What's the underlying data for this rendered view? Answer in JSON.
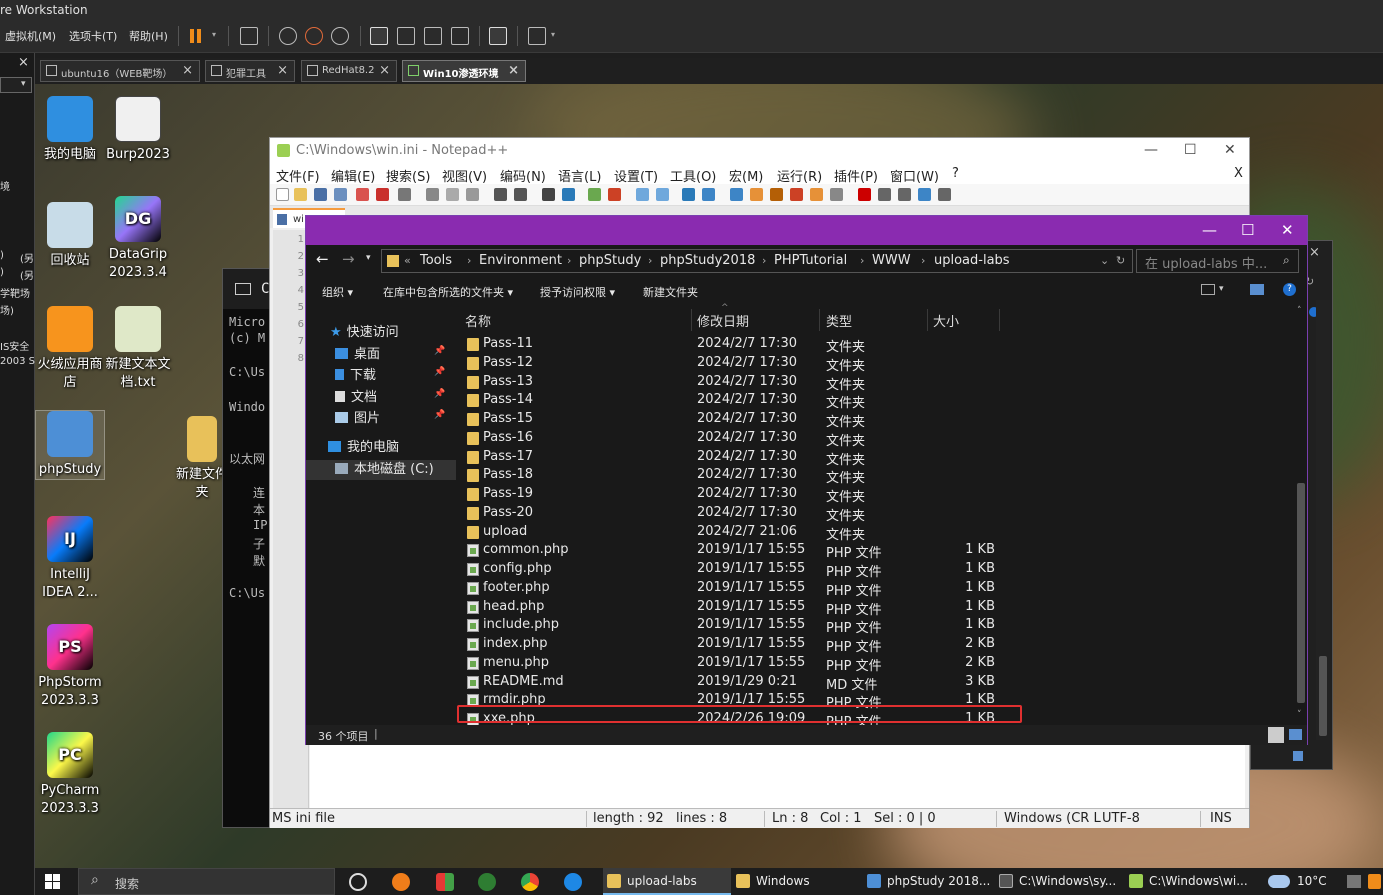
{
  "vmware": {
    "title": "re Workstation",
    "menus": [
      "虚拟机(M)",
      "选项卡(T)",
      "帮助(H)"
    ],
    "tabs": [
      {
        "label": "ubuntu16（WEB靶场）"
      },
      {
        "label": "犯罪工具"
      },
      {
        "label": "RedHat8.2"
      },
      {
        "label": "Win10渗透环境",
        "active": true
      }
    ],
    "library_fragments": [
      "境",
      ")",
      "(另",
      ")",
      "(另",
      "学靶场",
      "场)",
      "IS安全",
      "2003 S"
    ]
  },
  "desktop": {
    "icons": [
      {
        "label": "我的电脑"
      },
      {
        "label": "Burp2023"
      },
      {
        "label": "回收站"
      },
      {
        "label": "DataGrip 2023.3.4",
        "badge": "DG"
      },
      {
        "label": "火绒应用商店"
      },
      {
        "label": "新建文本文档.txt"
      },
      {
        "label": "phpStudy"
      },
      {
        "label": "新建文件夹"
      },
      {
        "label": "IntelliJ IDEA 2...",
        "badge": "IJ"
      },
      {
        "label": "PhpStorm 2023.3.3",
        "badge": "PS"
      },
      {
        "label": "PyCharm 2023.3.3",
        "badge": "PC"
      }
    ]
  },
  "cmd": {
    "title_icon": "C",
    "lines": [
      "Micro",
      "(c) M",
      "C:\\Us",
      "Windo",
      "以太网",
      "连",
      "本",
      "IP",
      "子",
      "默",
      "C:\\Us"
    ]
  },
  "notepad": {
    "title": "C:\\Windows\\win.ini - Notepad++",
    "menus": [
      "文件(F)",
      "编辑(E)",
      "搜索(S)",
      "视图(V)",
      "编码(N)",
      "语言(L)",
      "设置(T)",
      "工具(O)",
      "宏(M)",
      "运行(R)",
      "插件(P)",
      "窗口(W)",
      "?"
    ],
    "close_x": "X",
    "tab_label": "wi",
    "line_numbers": [
      "1",
      "2",
      "3",
      "4",
      "5",
      "6",
      "7",
      "8"
    ],
    "status": {
      "filetype": "MS ini file",
      "length": "length : 92",
      "lines": "lines : 8",
      "ln": "Ln : 8",
      "col": "Col : 1",
      "sel": "Sel : 0 | 0",
      "eol": "Windows (CR L",
      "encoding": "UTF-8",
      "mode": "INS"
    }
  },
  "explorer": {
    "breadcrumbs": [
      "Tools",
      "Environment",
      "phpStudy",
      "phpStudy2018",
      "PHPTutorial",
      "WWW",
      "upload-labs"
    ],
    "search_placeholder": "在 upload-labs 中...",
    "commands": [
      "组织",
      "在库中包含所选的文件夹",
      "授予访问权限",
      "新建文件夹"
    ],
    "nav": {
      "quick_access": "快速访问",
      "items": [
        "桌面",
        "下载",
        "文档",
        "图片"
      ],
      "this_pc": "我的电脑",
      "local_disk": "本地磁盘 (C:)"
    },
    "columns": [
      "名称",
      "修改日期",
      "类型",
      "大小"
    ],
    "rows": [
      {
        "name": "Pass-11",
        "date": "2024/2/7 17:30",
        "type": "文件夹",
        "size": "",
        "kind": "folder"
      },
      {
        "name": "Pass-12",
        "date": "2024/2/7 17:30",
        "type": "文件夹",
        "size": "",
        "kind": "folder"
      },
      {
        "name": "Pass-13",
        "date": "2024/2/7 17:30",
        "type": "文件夹",
        "size": "",
        "kind": "folder"
      },
      {
        "name": "Pass-14",
        "date": "2024/2/7 17:30",
        "type": "文件夹",
        "size": "",
        "kind": "folder"
      },
      {
        "name": "Pass-15",
        "date": "2024/2/7 17:30",
        "type": "文件夹",
        "size": "",
        "kind": "folder"
      },
      {
        "name": "Pass-16",
        "date": "2024/2/7 17:30",
        "type": "文件夹",
        "size": "",
        "kind": "folder"
      },
      {
        "name": "Pass-17",
        "date": "2024/2/7 17:30",
        "type": "文件夹",
        "size": "",
        "kind": "folder"
      },
      {
        "name": "Pass-18",
        "date": "2024/2/7 17:30",
        "type": "文件夹",
        "size": "",
        "kind": "folder"
      },
      {
        "name": "Pass-19",
        "date": "2024/2/7 17:30",
        "type": "文件夹",
        "size": "",
        "kind": "folder"
      },
      {
        "name": "Pass-20",
        "date": "2024/2/7 17:30",
        "type": "文件夹",
        "size": "",
        "kind": "folder"
      },
      {
        "name": "upload",
        "date": "2024/2/7 21:06",
        "type": "文件夹",
        "size": "",
        "kind": "folder"
      },
      {
        "name": "common.php",
        "date": "2019/1/17 15:55",
        "type": "PHP 文件",
        "size": "1 KB",
        "kind": "php"
      },
      {
        "name": "config.php",
        "date": "2019/1/17 15:55",
        "type": "PHP 文件",
        "size": "1 KB",
        "kind": "php"
      },
      {
        "name": "footer.php",
        "date": "2019/1/17 15:55",
        "type": "PHP 文件",
        "size": "1 KB",
        "kind": "php"
      },
      {
        "name": "head.php",
        "date": "2019/1/17 15:55",
        "type": "PHP 文件",
        "size": "1 KB",
        "kind": "php"
      },
      {
        "name": "include.php",
        "date": "2019/1/17 15:55",
        "type": "PHP 文件",
        "size": "1 KB",
        "kind": "php"
      },
      {
        "name": "index.php",
        "date": "2019/1/17 15:55",
        "type": "PHP 文件",
        "size": "2 KB",
        "kind": "php"
      },
      {
        "name": "menu.php",
        "date": "2019/1/17 15:55",
        "type": "PHP 文件",
        "size": "2 KB",
        "kind": "php"
      },
      {
        "name": "README.md",
        "date": "2019/1/29 0:21",
        "type": "MD 文件",
        "size": "3 KB",
        "kind": "php"
      },
      {
        "name": "rmdir.php",
        "date": "2019/1/17 15:55",
        "type": "PHP 文件",
        "size": "1 KB",
        "kind": "php"
      },
      {
        "name": "xxe.php",
        "date": "2024/2/26 19:09",
        "type": "PHP 文件",
        "size": "1 KB",
        "kind": "php",
        "highlighted": true
      }
    ],
    "item_count": "36 个项目"
  },
  "taskbar": {
    "search_label": "搜索",
    "tasks": [
      {
        "label": "upload-labs",
        "active": true
      },
      {
        "label": "Windows"
      },
      {
        "label": "phpStudy 2018..."
      },
      {
        "label": "C:\\Windows\\sy..."
      },
      {
        "label": "C:\\Windows\\wi..."
      }
    ],
    "temperature": "10°C"
  }
}
